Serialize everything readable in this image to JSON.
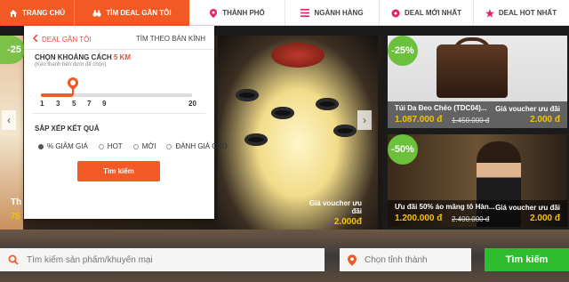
{
  "nav": {
    "items": [
      {
        "label": "Trang chủ",
        "icon": "home-icon",
        "active": true
      },
      {
        "label": "Tìm deal gần tôi",
        "icon": "binoculars-icon",
        "active": true
      },
      {
        "label": "Thành phố",
        "icon": "map-pin-icon",
        "active": false
      },
      {
        "label": "Ngành hàng",
        "icon": "list-icon",
        "active": false
      },
      {
        "label": "Deal mới nhất",
        "icon": "tag-icon",
        "active": false
      },
      {
        "label": "Deal hot nhất",
        "icon": "star-icon",
        "active": false
      }
    ]
  },
  "panel": {
    "back_label": "Deal gần tôi",
    "mode_label": "Tìm theo bán kính",
    "distance_label_prefix": "Chọn khoảng cách",
    "distance_value": "5 km",
    "hint": "(Kéo thanh bên dưới để chọn)",
    "slider": {
      "value": 5,
      "min": 1,
      "max": 20,
      "ticks": [
        "1",
        "3",
        "5",
        "7",
        "9",
        "20"
      ]
    },
    "sort_label": "Sắp xếp kết quả",
    "sort_options": [
      {
        "label": "% giảm giá",
        "selected": true
      },
      {
        "label": "Hot",
        "selected": false
      },
      {
        "label": "Mới",
        "selected": false
      },
      {
        "label": "Đánh giá cao",
        "selected": false
      }
    ],
    "search_button": "Tìm kiếm"
  },
  "banner": {
    "left_badge": "-25",
    "left_title": "Th",
    "left_price": "75",
    "voucher_label": "Giá voucher ưu đãi",
    "voucher_price": "2.000đ",
    "arrow_left": "‹",
    "arrow_right": "›"
  },
  "deals": [
    {
      "badge": "-25%",
      "title": "Túi Da Đeo Chéo (TDC04)...",
      "price": "1.087.000 đ",
      "old_price": "1.450.000 đ",
      "voucher_label": "Giá voucher ưu đãi",
      "voucher_price": "2.000 đ"
    },
    {
      "badge": "-50%",
      "title": "Ưu đãi 50% áo măng tô Hàn...",
      "price": "1.200.000 đ",
      "old_price": "2.400.000 đ",
      "voucher_label": "Giá voucher ưu đãi",
      "voucher_price": "2.000 đ"
    }
  ],
  "search": {
    "product_placeholder": "Tìm kiếm sản phẩm/khuyến mại",
    "city_placeholder": "Chọn tỉnh thành",
    "button": "Tìm kiếm"
  },
  "colors": {
    "accent": "#f15a24",
    "green": "#2ebd2e",
    "badge_green": "#6cc13c",
    "price_yellow": "#f5c400"
  }
}
